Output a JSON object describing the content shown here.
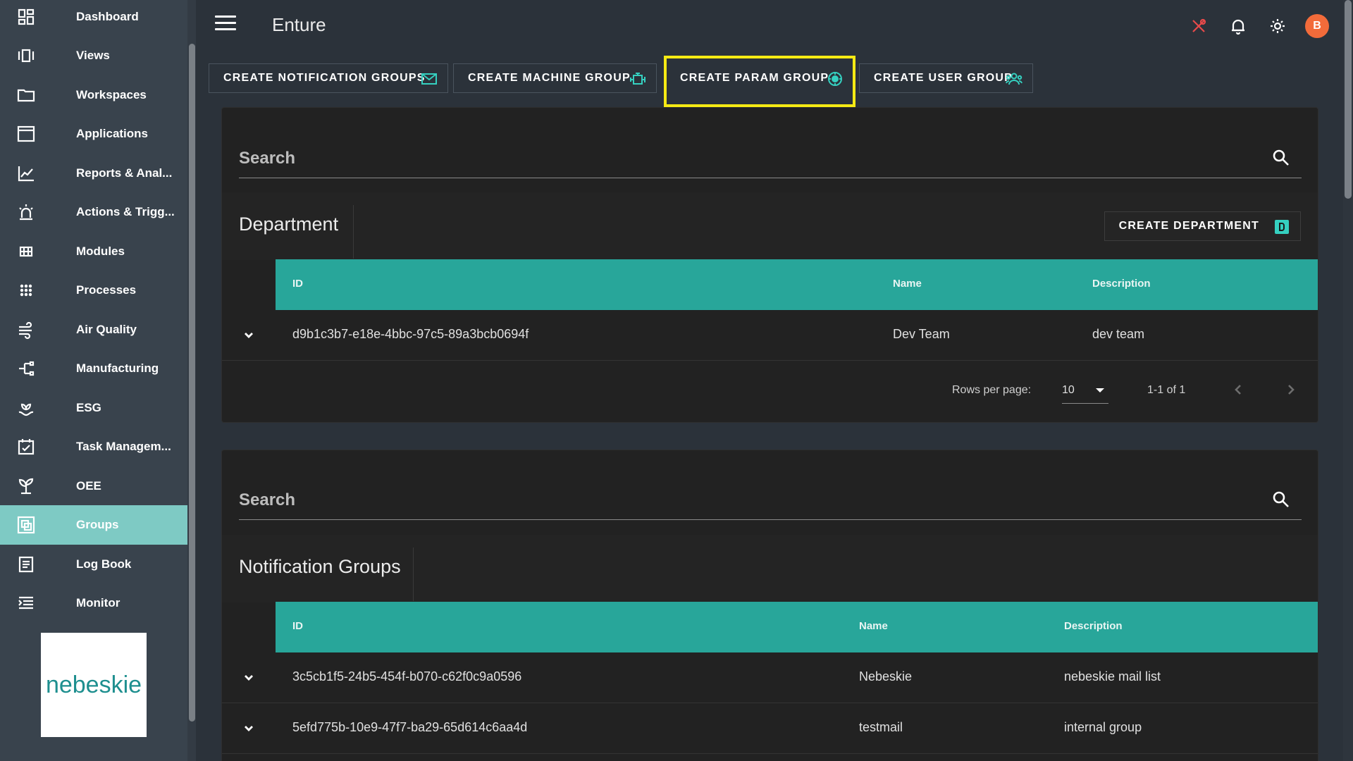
{
  "app": {
    "title": "Enture",
    "avatar_letter": "B"
  },
  "sidebar": {
    "items": [
      {
        "label": "Dashboard",
        "icon": "dashboard-icon"
      },
      {
        "label": "Views",
        "icon": "views-icon"
      },
      {
        "label": "Workspaces",
        "icon": "folder-icon"
      },
      {
        "label": "Applications",
        "icon": "window-icon"
      },
      {
        "label": "Reports & Anal...",
        "icon": "chart-line-icon"
      },
      {
        "label": "Actions & Trigg...",
        "icon": "alarm-light-icon"
      },
      {
        "label": "Modules",
        "icon": "grid-icon"
      },
      {
        "label": "Processes",
        "icon": "dots-grid-icon"
      },
      {
        "label": "Air Quality",
        "icon": "wind-icon"
      },
      {
        "label": "Manufacturing",
        "icon": "tree-structure-icon"
      },
      {
        "label": "ESG",
        "icon": "plant-hand-icon"
      },
      {
        "label": "Task Managem...",
        "icon": "calendar-check-icon"
      },
      {
        "label": "OEE",
        "icon": "sprout-icon"
      },
      {
        "label": "Groups",
        "icon": "group-icon"
      },
      {
        "label": "Log Book",
        "icon": "log-book-icon"
      },
      {
        "label": "Monitor",
        "icon": "monitor-list-icon"
      }
    ],
    "active": "Groups",
    "logo_text": "nebeskie"
  },
  "actions": [
    {
      "label": "CREATE NOTIFICATION GROUPS",
      "icon": "mail-icon"
    },
    {
      "label": "CREATE MACHINE GROUP",
      "icon": "engine-icon"
    },
    {
      "label": "CREATE PARAM GROUP",
      "icon": "param-icon"
    },
    {
      "label": "CREATE USER GROUP",
      "icon": "users-icon"
    }
  ],
  "highlighted_action": "CREATE PARAM GROUP",
  "department": {
    "search_placeholder": "Search",
    "title": "Department",
    "create_label": "CREATE DEPARTMENT",
    "columns": [
      "ID",
      "Name",
      "Description"
    ],
    "rows": [
      {
        "id": "d9b1c3b7-e18e-4bbc-97c5-89a3bcb0694f",
        "name": "Dev Team",
        "description": "dev team"
      }
    ],
    "rows_per_page_label": "Rows per page:",
    "rows_per_page": "10",
    "range": "1-1 of 1"
  },
  "notification_groups": {
    "search_placeholder": "Search",
    "title": "Notification Groups",
    "columns": [
      "ID",
      "Name",
      "Description"
    ],
    "rows": [
      {
        "id": "3c5cb1f5-24b5-454f-b070-c62f0c9a0596",
        "name": "Nebeskie",
        "description": "nebeskie mail list"
      },
      {
        "id": "5efd775b-10e9-47f7-ba29-65d614c6aa4d",
        "name": "testmail",
        "description": "internal group"
      }
    ]
  },
  "colors": {
    "accent": "#28a69a",
    "active_nav": "#7ecac4",
    "highlight": "#f5ea14",
    "avatar": "#f26b3a"
  }
}
